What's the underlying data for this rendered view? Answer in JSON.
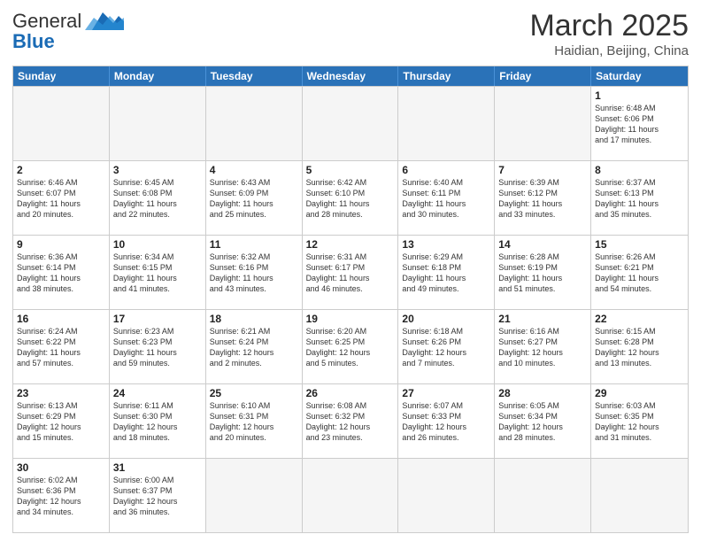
{
  "header": {
    "logo_general": "General",
    "logo_blue": "Blue",
    "month_title": "March 2025",
    "subtitle": "Haidian, Beijing, China"
  },
  "days_of_week": [
    "Sunday",
    "Monday",
    "Tuesday",
    "Wednesday",
    "Thursday",
    "Friday",
    "Saturday"
  ],
  "weeks": [
    [
      {
        "day": "",
        "text": ""
      },
      {
        "day": "",
        "text": ""
      },
      {
        "day": "",
        "text": ""
      },
      {
        "day": "",
        "text": ""
      },
      {
        "day": "",
        "text": ""
      },
      {
        "day": "",
        "text": ""
      },
      {
        "day": "1",
        "text": "Sunrise: 6:48 AM\nSunset: 6:06 PM\nDaylight: 11 hours\nand 17 minutes."
      }
    ],
    [
      {
        "day": "2",
        "text": "Sunrise: 6:46 AM\nSunset: 6:07 PM\nDaylight: 11 hours\nand 20 minutes."
      },
      {
        "day": "3",
        "text": "Sunrise: 6:45 AM\nSunset: 6:08 PM\nDaylight: 11 hours\nand 22 minutes."
      },
      {
        "day": "4",
        "text": "Sunrise: 6:43 AM\nSunset: 6:09 PM\nDaylight: 11 hours\nand 25 minutes."
      },
      {
        "day": "5",
        "text": "Sunrise: 6:42 AM\nSunset: 6:10 PM\nDaylight: 11 hours\nand 28 minutes."
      },
      {
        "day": "6",
        "text": "Sunrise: 6:40 AM\nSunset: 6:11 PM\nDaylight: 11 hours\nand 30 minutes."
      },
      {
        "day": "7",
        "text": "Sunrise: 6:39 AM\nSunset: 6:12 PM\nDaylight: 11 hours\nand 33 minutes."
      },
      {
        "day": "8",
        "text": "Sunrise: 6:37 AM\nSunset: 6:13 PM\nDaylight: 11 hours\nand 35 minutes."
      }
    ],
    [
      {
        "day": "9",
        "text": "Sunrise: 6:36 AM\nSunset: 6:14 PM\nDaylight: 11 hours\nand 38 minutes."
      },
      {
        "day": "10",
        "text": "Sunrise: 6:34 AM\nSunset: 6:15 PM\nDaylight: 11 hours\nand 41 minutes."
      },
      {
        "day": "11",
        "text": "Sunrise: 6:32 AM\nSunset: 6:16 PM\nDaylight: 11 hours\nand 43 minutes."
      },
      {
        "day": "12",
        "text": "Sunrise: 6:31 AM\nSunset: 6:17 PM\nDaylight: 11 hours\nand 46 minutes."
      },
      {
        "day": "13",
        "text": "Sunrise: 6:29 AM\nSunset: 6:18 PM\nDaylight: 11 hours\nand 49 minutes."
      },
      {
        "day": "14",
        "text": "Sunrise: 6:28 AM\nSunset: 6:19 PM\nDaylight: 11 hours\nand 51 minutes."
      },
      {
        "day": "15",
        "text": "Sunrise: 6:26 AM\nSunset: 6:21 PM\nDaylight: 11 hours\nand 54 minutes."
      }
    ],
    [
      {
        "day": "16",
        "text": "Sunrise: 6:24 AM\nSunset: 6:22 PM\nDaylight: 11 hours\nand 57 minutes."
      },
      {
        "day": "17",
        "text": "Sunrise: 6:23 AM\nSunset: 6:23 PM\nDaylight: 11 hours\nand 59 minutes."
      },
      {
        "day": "18",
        "text": "Sunrise: 6:21 AM\nSunset: 6:24 PM\nDaylight: 12 hours\nand 2 minutes."
      },
      {
        "day": "19",
        "text": "Sunrise: 6:20 AM\nSunset: 6:25 PM\nDaylight: 12 hours\nand 5 minutes."
      },
      {
        "day": "20",
        "text": "Sunrise: 6:18 AM\nSunset: 6:26 PM\nDaylight: 12 hours\nand 7 minutes."
      },
      {
        "day": "21",
        "text": "Sunrise: 6:16 AM\nSunset: 6:27 PM\nDaylight: 12 hours\nand 10 minutes."
      },
      {
        "day": "22",
        "text": "Sunrise: 6:15 AM\nSunset: 6:28 PM\nDaylight: 12 hours\nand 13 minutes."
      }
    ],
    [
      {
        "day": "23",
        "text": "Sunrise: 6:13 AM\nSunset: 6:29 PM\nDaylight: 12 hours\nand 15 minutes."
      },
      {
        "day": "24",
        "text": "Sunrise: 6:11 AM\nSunset: 6:30 PM\nDaylight: 12 hours\nand 18 minutes."
      },
      {
        "day": "25",
        "text": "Sunrise: 6:10 AM\nSunset: 6:31 PM\nDaylight: 12 hours\nand 20 minutes."
      },
      {
        "day": "26",
        "text": "Sunrise: 6:08 AM\nSunset: 6:32 PM\nDaylight: 12 hours\nand 23 minutes."
      },
      {
        "day": "27",
        "text": "Sunrise: 6:07 AM\nSunset: 6:33 PM\nDaylight: 12 hours\nand 26 minutes."
      },
      {
        "day": "28",
        "text": "Sunrise: 6:05 AM\nSunset: 6:34 PM\nDaylight: 12 hours\nand 28 minutes."
      },
      {
        "day": "29",
        "text": "Sunrise: 6:03 AM\nSunset: 6:35 PM\nDaylight: 12 hours\nand 31 minutes."
      }
    ],
    [
      {
        "day": "30",
        "text": "Sunrise: 6:02 AM\nSunset: 6:36 PM\nDaylight: 12 hours\nand 34 minutes."
      },
      {
        "day": "31",
        "text": "Sunrise: 6:00 AM\nSunset: 6:37 PM\nDaylight: 12 hours\nand 36 minutes."
      },
      {
        "day": "",
        "text": ""
      },
      {
        "day": "",
        "text": ""
      },
      {
        "day": "",
        "text": ""
      },
      {
        "day": "",
        "text": ""
      },
      {
        "day": "",
        "text": ""
      }
    ]
  ]
}
